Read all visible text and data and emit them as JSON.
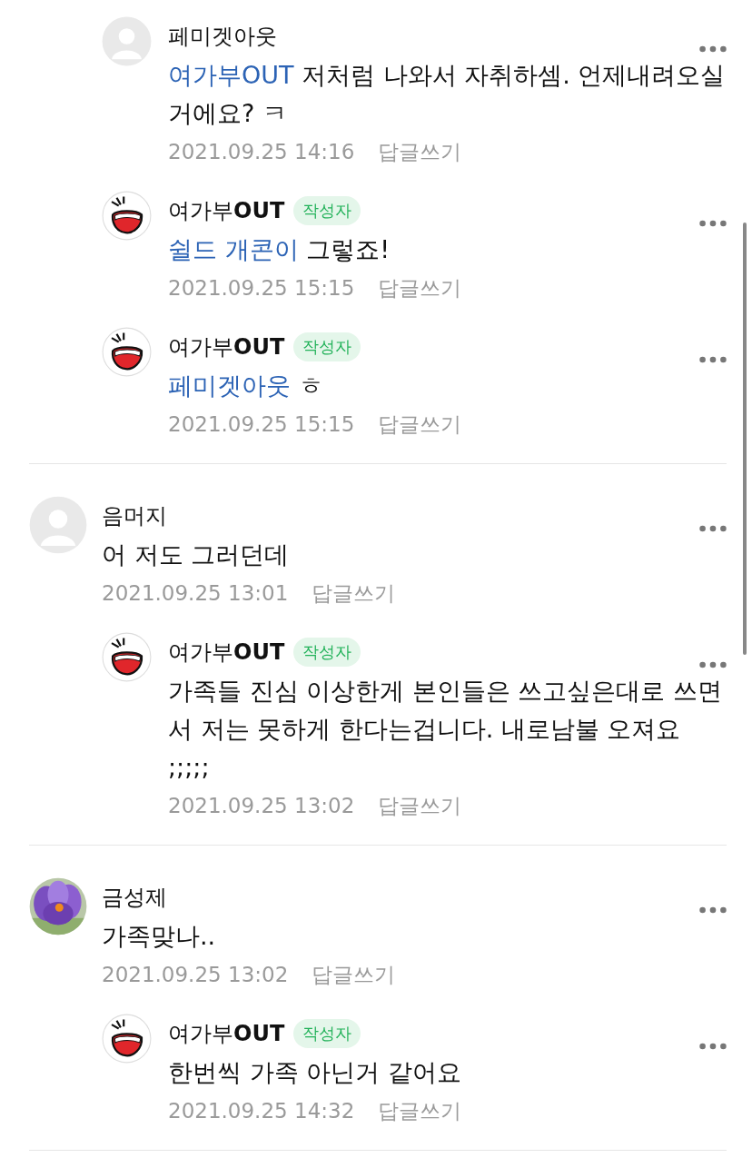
{
  "threads": [
    {
      "comments": [
        {
          "reply": true,
          "avatar": {
            "kind": "default"
          },
          "name": "페미겟아웃",
          "mention": "여가부OUT",
          "text": "저처럼 나와서 자취하셈. 언제내려오실거에요? ㅋ",
          "date": "2021.09.25 14:16",
          "reply_label": "답글쓰기"
        },
        {
          "reply": true,
          "avatar": {
            "kind": "cartoon"
          },
          "name": "여가부**OUT**",
          "badge": "작성자",
          "mention": "쉴드 개콘이",
          "text": "그렇죠!",
          "date": "2021.09.25 15:15",
          "reply_label": "답글쓰기"
        },
        {
          "reply": true,
          "avatar": {
            "kind": "cartoon"
          },
          "name": "여가부**OUT**",
          "badge": "작성자",
          "mention": "페미겟아웃",
          "text": "ㅎ",
          "date": "2021.09.25 15:15",
          "reply_label": "답글쓰기"
        }
      ]
    },
    {
      "comments": [
        {
          "reply": false,
          "avatar": {
            "kind": "default"
          },
          "name": "음머지",
          "text": "어 저도 그러던데",
          "date": "2021.09.25 13:01",
          "reply_label": "답글쓰기"
        },
        {
          "reply": true,
          "avatar": {
            "kind": "cartoon"
          },
          "name": "여가부**OUT**",
          "badge": "작성자",
          "text": "가족들 진심 이상한게 본인들은 쓰고싶은대로 쓰면서 저는 못하게 한다는겁니다. 내로남불 오져요 ;;;;;",
          "date": "2021.09.25 13:02",
          "reply_label": "답글쓰기"
        }
      ]
    },
    {
      "comments": [
        {
          "reply": false,
          "name": "금성제",
          "text": "가족맞나..",
          "date": "2021.09.25 13:02",
          "reply_label": "답글쓰기"
        },
        {
          "reply": true,
          "avatar": {
            "kind": "cartoon"
          },
          "name": "여가부**OUT**",
          "badge": "작성자",
          "text": "한번씩 가족 아닌거 같어요",
          "date": "2021.09.25 14:32",
          "reply_label": "답글쓰기"
        }
      ]
    }
  ]
}
